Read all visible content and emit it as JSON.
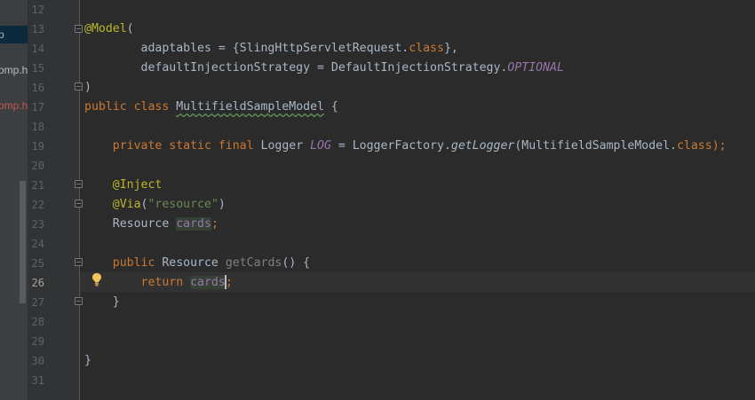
{
  "project_panel": {
    "items": [
      {
        "label": "p",
        "state": "selected"
      },
      {
        "label": "omp.h",
        "state": "normal"
      },
      {
        "label": "omp.h",
        "state": "modified"
      }
    ]
  },
  "editor": {
    "current_line": "26",
    "line_numbers": [
      "12",
      "13",
      "14",
      "15",
      "16",
      "17",
      "18",
      "19",
      "20",
      "21",
      "22",
      "23",
      "24",
      "25",
      "26",
      "27",
      "28",
      "29",
      "30",
      "31"
    ],
    "code": {
      "l13_ann": "@Model",
      "l13_rest": "(",
      "l14_a": "        adaptables = {SlingHttpServletRequest.",
      "l14_kw": "class",
      "l14_b": "},",
      "l15_a": "        defaultInjectionStrategy = DefaultInjectionStrategy.",
      "l15_const": "OPTIONAL",
      "l16": ")",
      "l17_kw": "public class ",
      "l17_name": "MultifieldSampleModel",
      "l17_rest": " {",
      "l19_indent": "    ",
      "l19_kw": "private static final ",
      "l19_type": "Logger ",
      "l19_field": "LOG",
      "l19_eq": " = LoggerFactory.",
      "l19_call": "getLogger",
      "l19_args": "(MultifieldSampleModel.",
      "l19_class": "class",
      "l19_end": ");",
      "l21_indent": "    ",
      "l21_ann": "@Inject",
      "l22_indent": "    ",
      "l22_ann": "@Via",
      "l22_open": "(",
      "l22_str": "\"resource\"",
      "l22_close": ")",
      "l23_indent": "    ",
      "l23_type": "Resource ",
      "l23_field": "cards",
      "l23_semi": ";",
      "l25_indent": "    ",
      "l25_kw": "public ",
      "l25_type": "Resource ",
      "l25_name": "getCards",
      "l25_rest": "() {",
      "l26_indent": "        ",
      "l26_kw": "return ",
      "l26_field": "cards",
      "l26_semi": ";",
      "l27": "    }",
      "l30": "}"
    }
  },
  "colors": {
    "background": "#2b2b2b",
    "keyword": "#cc7832",
    "annotation": "#bbb529",
    "string": "#6a8759",
    "field": "#9876aa",
    "text": "#a9b7c6"
  },
  "icons": {
    "intention": "lightbulb-icon",
    "fold": "fold-marker-icon"
  }
}
